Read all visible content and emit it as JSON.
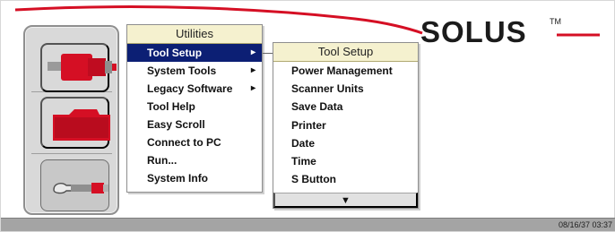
{
  "brand": {
    "logo_text": "SOLUS",
    "tm_mark": "TM"
  },
  "utilities_menu": {
    "title": "Utilities",
    "items": [
      {
        "label": "Tool Setup",
        "arrow": "▸"
      },
      {
        "label": "System Tools",
        "arrow": "▸"
      },
      {
        "label": "Legacy Software",
        "arrow": "▸"
      },
      {
        "label": "Tool Help"
      },
      {
        "label": "Easy Scroll"
      },
      {
        "label": "Connect to PC"
      },
      {
        "label": "Run..."
      },
      {
        "label": "System Info"
      }
    ]
  },
  "tool_setup_menu": {
    "title": "Tool Setup",
    "items": [
      {
        "label": "Power Management"
      },
      {
        "label": "Scanner Units"
      },
      {
        "label": "Save Data"
      },
      {
        "label": "Printer"
      },
      {
        "label": "Date"
      },
      {
        "label": "Time"
      },
      {
        "label": "S Button"
      }
    ],
    "scroll_icon": "▼"
  },
  "status_bar": {
    "date_time": "08/16/37 03:37"
  },
  "icons": {
    "diagnostic": "scanner-connector-icon",
    "data": "folder-icon",
    "utilities": "wrench-icon"
  },
  "colors": {
    "accent_red": "#d50f24",
    "selection_blue": "#0c1f74",
    "menu_header": "#f5f1cf"
  }
}
